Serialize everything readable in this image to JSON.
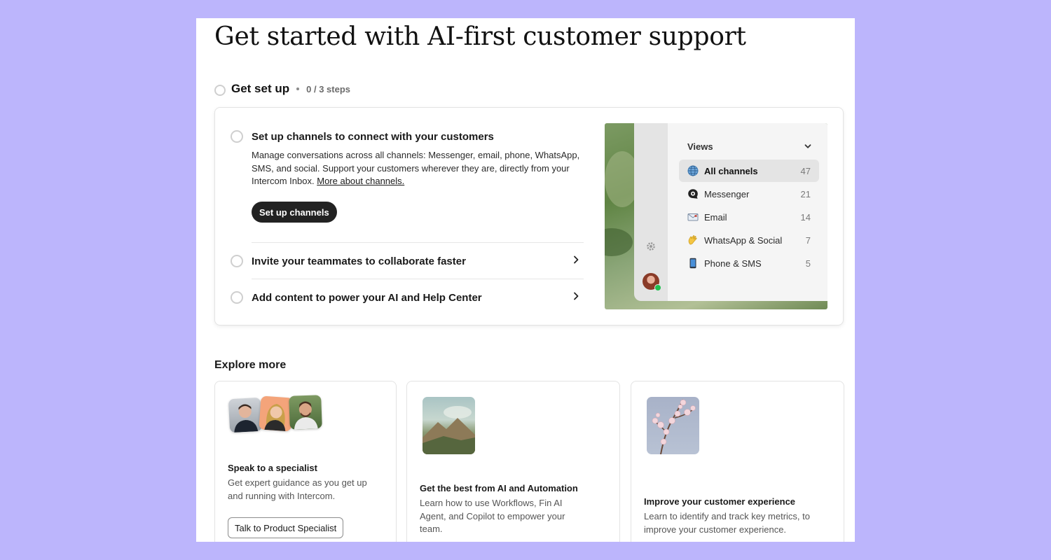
{
  "page": {
    "title": "Get started with AI-first customer support"
  },
  "setup": {
    "title": "Get set up",
    "progress": "0 / 3 steps",
    "steps": [
      {
        "title": "Set up channels to connect with your customers",
        "description": "Manage conversations across all channels: Messenger, email, phone, WhatsApp, SMS, and social. Support your customers wherever they are, directly from your Intercom Inbox.",
        "link_label": "More about channels.",
        "button_label": "Set up channels"
      },
      {
        "title": "Invite your teammates to collaborate faster"
      },
      {
        "title": "Add content to power your AI and Help Center"
      }
    ]
  },
  "preview": {
    "views_title": "Views",
    "items": [
      {
        "label": "All channels",
        "count": "47",
        "icon": "globe-icon"
      },
      {
        "label": "Messenger",
        "count": "21",
        "icon": "messenger-icon"
      },
      {
        "label": "Email",
        "count": "14",
        "icon": "envelope-icon"
      },
      {
        "label": "WhatsApp & Social",
        "count": "7",
        "icon": "waving-hand-icon"
      },
      {
        "label": "Phone & SMS",
        "count": "5",
        "icon": "mobile-phone-icon"
      }
    ]
  },
  "explore": {
    "title": "Explore more",
    "cards": [
      {
        "title": "Speak to a specialist",
        "description": "Get expert guidance as you get up and running with Intercom.",
        "button_label": "Talk to Product Specialist"
      },
      {
        "title": "Get the best from AI and Automation",
        "description": "Learn how to use Workflows, Fin AI Agent, and Copilot to empower your team."
      },
      {
        "title": "Improve your customer experience",
        "description": "Learn to identify and track key metrics, to improve your customer experience."
      }
    ]
  },
  "colors": {
    "background": "#bcb5fc",
    "primary_button": "#222222",
    "online_dot": "#1fbf4f"
  }
}
